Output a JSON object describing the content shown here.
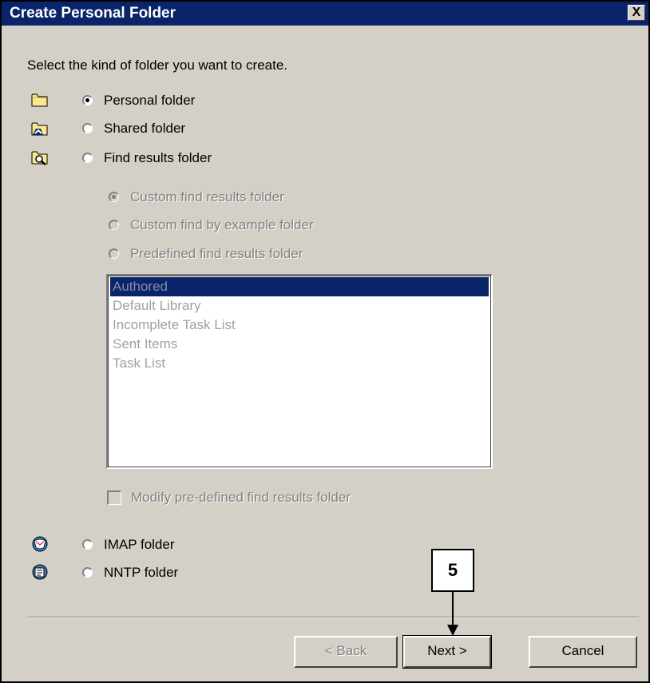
{
  "window": {
    "title": "Create Personal Folder",
    "close_symbol": "X"
  },
  "instruction": "Select the kind of folder you want to create.",
  "folder_types": [
    {
      "label": "Personal folder",
      "icon": "personal-folder-icon",
      "checked": true
    },
    {
      "label": "Shared folder",
      "icon": "shared-folder-icon",
      "checked": false
    },
    {
      "label": "Find results folder",
      "icon": "find-results-folder-icon",
      "checked": false
    }
  ],
  "find_options": [
    {
      "label": "Custom find results folder",
      "checked": true,
      "disabled": true
    },
    {
      "label": "Custom find by example folder",
      "checked": false,
      "disabled": true
    },
    {
      "label": "Predefined find results folder",
      "checked": false,
      "disabled": true
    }
  ],
  "predefined_list": {
    "items": [
      "Authored",
      "Default Library",
      "Incomplete Task List",
      "Sent Items",
      "Task List"
    ],
    "selected": "Authored"
  },
  "modify_checkbox": {
    "label": "Modify pre-defined find results folder",
    "checked": false,
    "disabled": true
  },
  "other_types": [
    {
      "label": "IMAP folder",
      "icon": "imap-folder-icon",
      "checked": false
    },
    {
      "label": "NNTP folder",
      "icon": "nntp-folder-icon",
      "checked": false
    }
  ],
  "buttons": {
    "back": "< Back",
    "next": "Next >",
    "cancel": "Cancel"
  },
  "callout": {
    "number": "5"
  },
  "colors": {
    "titlebar": "#0a246a",
    "dialog_bg": "#d4d0c8",
    "selection": "#0a246a",
    "disabled_text": "#808080"
  }
}
